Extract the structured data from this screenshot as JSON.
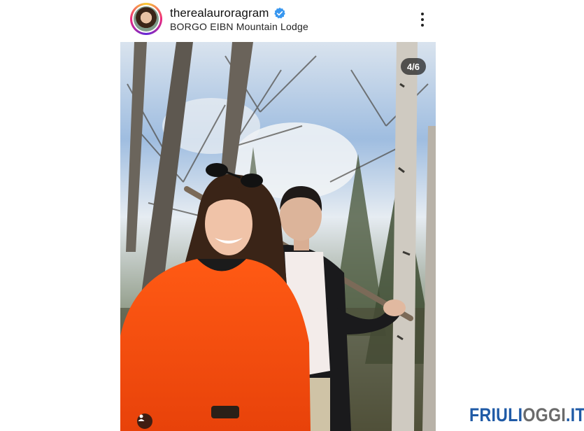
{
  "post": {
    "username": "therealauroragram",
    "verified": true,
    "location": "BORGO EIBN Mountain Lodge"
  },
  "carousel": {
    "counter": "4/6"
  },
  "icons": {
    "verified": "verified-badge-icon",
    "more": "more-options-icon",
    "tag": "user-tag-icon"
  },
  "watermark": {
    "part1": "FRIULI",
    "part2": "OGGI",
    "part3": ".IT"
  },
  "colors": {
    "verified_blue": "#3897f0",
    "watermark_blue": "#1f5aa6",
    "watermark_gray": "#6b6b6b",
    "sweater_orange": "#ff4d0a"
  }
}
